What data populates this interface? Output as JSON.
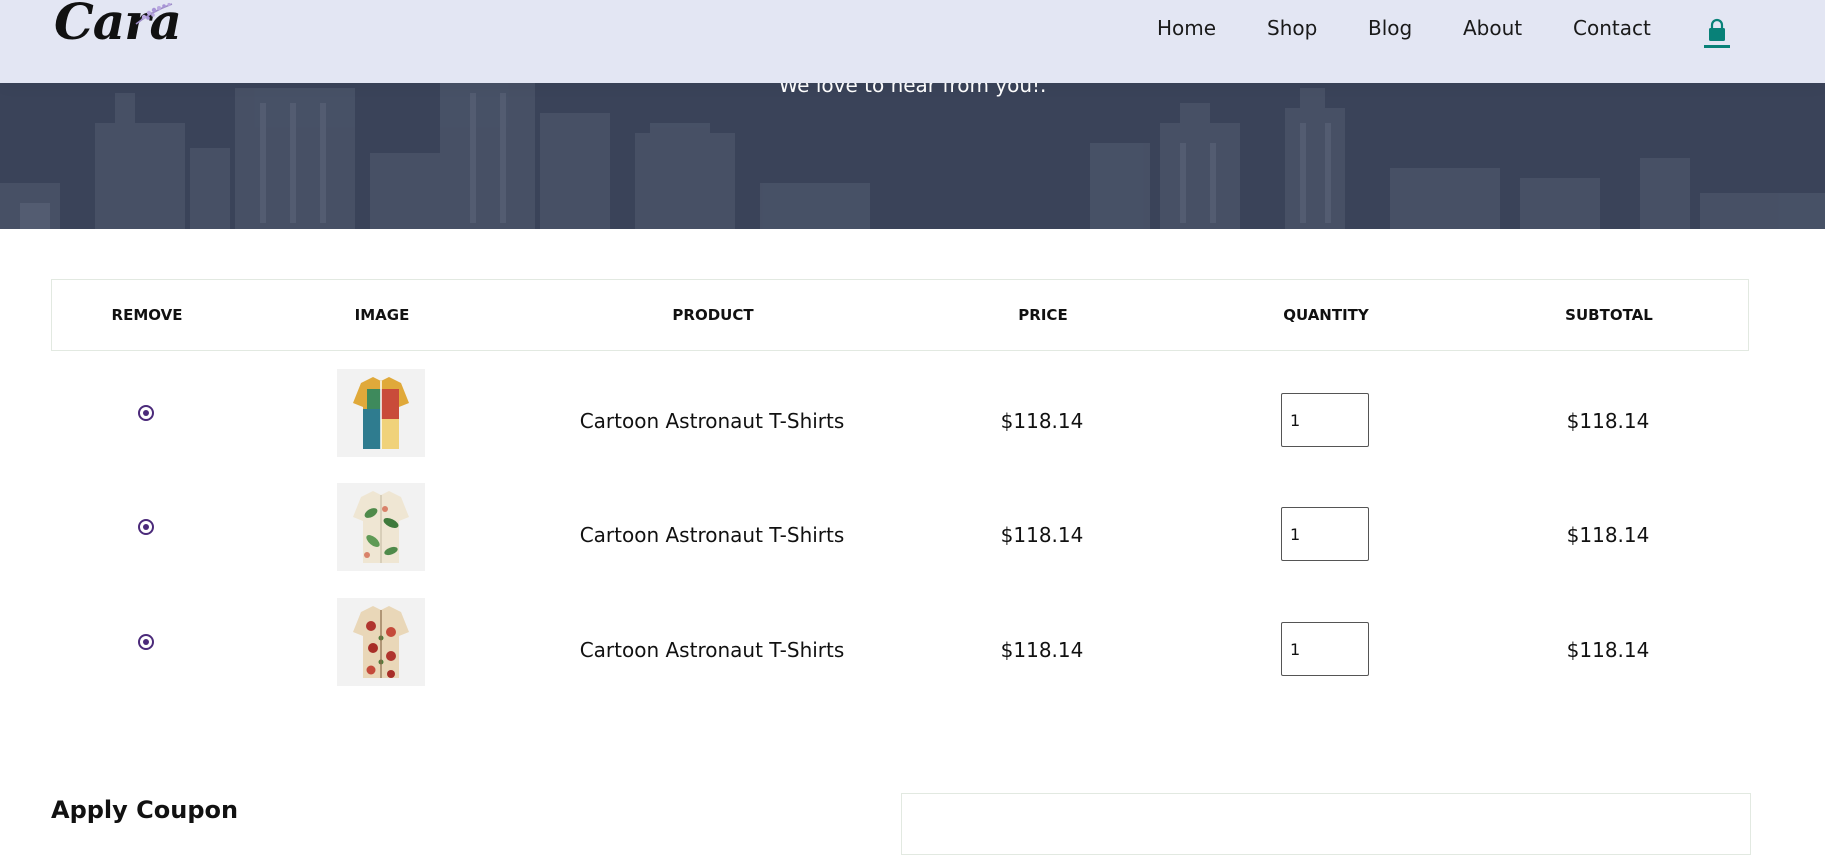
{
  "header": {
    "logo_text": "Cara",
    "nav": [
      "Home",
      "Shop",
      "Blog",
      "About",
      "Contact"
    ],
    "cart_icon": "shopping-bag-icon",
    "accent_color": "#088178"
  },
  "hero": {
    "subtitle": "We love to hear from you!."
  },
  "table": {
    "headers": [
      "REMOVE",
      "IMAGE",
      "PRODUCT",
      "PRICE",
      "QUANTITY",
      "SUBTOTAL"
    ],
    "rows": [
      {
        "image": "shirt-yellow-patchwork",
        "product": "Cartoon Astronaut T-Shirts",
        "price": "$118.14",
        "quantity": "1",
        "subtotal": "$118.14"
      },
      {
        "image": "shirt-green-leaf",
        "product": "Cartoon Astronaut T-Shirts",
        "price": "$118.14",
        "quantity": "1",
        "subtotal": "$118.14"
      },
      {
        "image": "shirt-red-floral",
        "product": "Cartoon Astronaut T-Shirts",
        "price": "$118.14",
        "quantity": "1",
        "subtotal": "$118.14"
      }
    ]
  },
  "coupon": {
    "title": "Apply Coupon"
  },
  "colors": {
    "remove_icon": "#4b2a7a",
    "hero_bg": "#3a4359",
    "header_bg": "#e3e6f3"
  }
}
